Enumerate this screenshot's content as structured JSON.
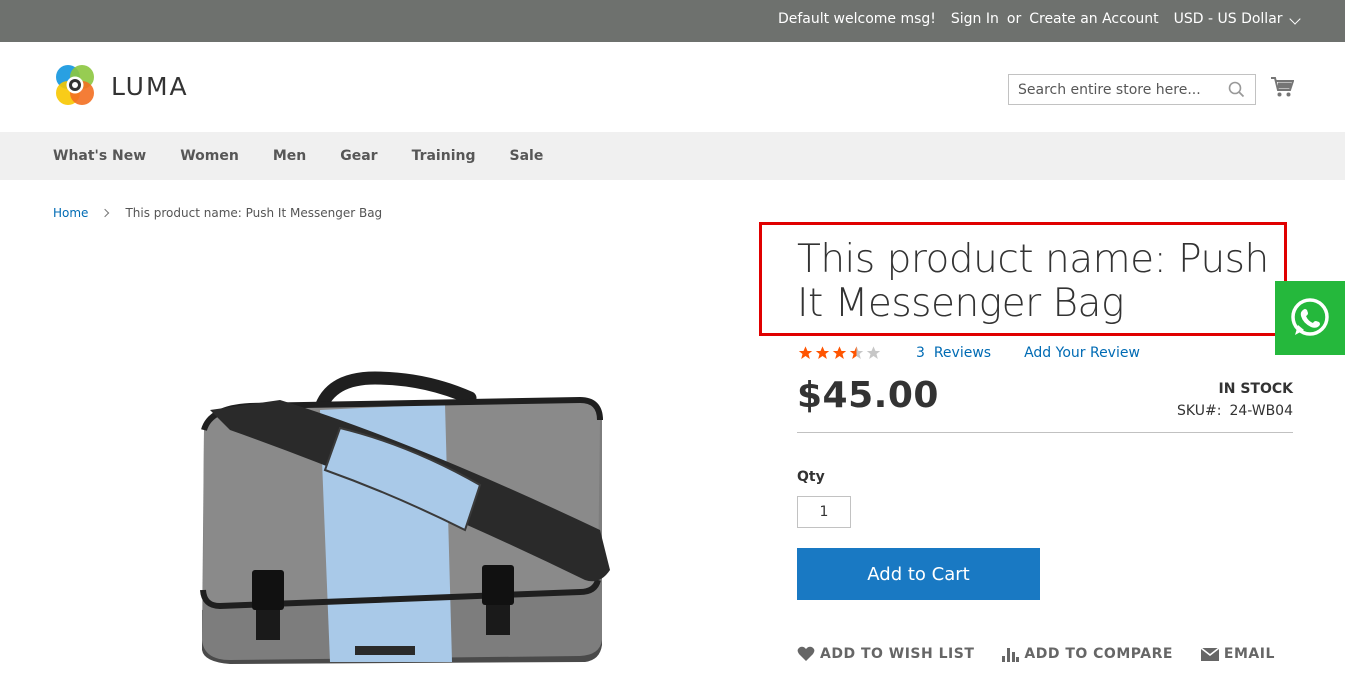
{
  "topbar": {
    "welcome": "Default welcome msg!",
    "sign_in": "Sign In",
    "or": "or",
    "create_account": "Create an Account",
    "currency": "USD - US Dollar"
  },
  "header": {
    "logo_text": "LUMA",
    "search_placeholder": "Search entire store here...",
    "search_value": ""
  },
  "nav": {
    "items": [
      {
        "label": "What's New"
      },
      {
        "label": "Women"
      },
      {
        "label": "Men"
      },
      {
        "label": "Gear"
      },
      {
        "label": "Training"
      },
      {
        "label": "Sale"
      }
    ]
  },
  "breadcrumb": {
    "home": "Home",
    "current": "This product name: Push It Messenger Bag"
  },
  "product": {
    "title": "This product name: Push It Messenger Bag",
    "rating": {
      "filled": 3,
      "half": 1,
      "total": 5
    },
    "review_count": "3",
    "reviews_label": "Reviews",
    "add_review": "Add Your Review",
    "price": "$45.00",
    "stock": "In stock",
    "sku_label": "SKU#:",
    "sku": "24-WB04",
    "qty_label": "Qty",
    "qty_value": "1",
    "add_to_cart": "Add to Cart",
    "actions": {
      "wishlist": "Add to Wish List",
      "compare": "Add to Compare",
      "email": "Email"
    }
  },
  "colors": {
    "topbar_bg": "#6e716e",
    "nav_bg": "#f0f0f0",
    "link": "#006bb4",
    "button": "#1979c3",
    "star": "#ff5501",
    "highlight": "#e00000",
    "whatsapp": "#25b83c"
  },
  "icons": {
    "search": "search-icon",
    "cart": "cart-icon",
    "whatsapp": "whatsapp-icon",
    "wishlist": "heart-icon",
    "compare": "bar-chart-icon",
    "email": "envelope-icon"
  }
}
